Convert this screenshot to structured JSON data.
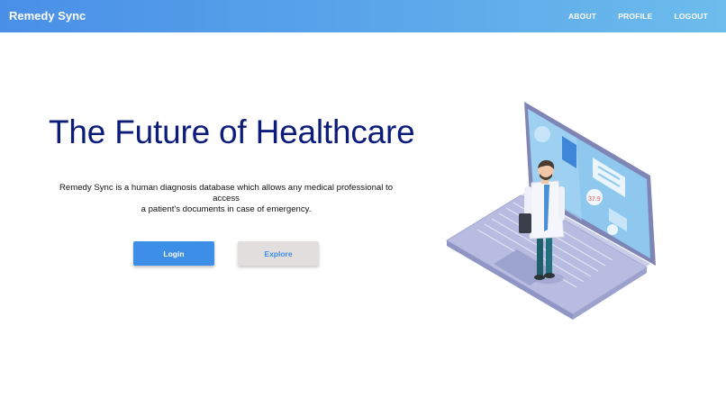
{
  "navbar": {
    "brand": "Remedy Sync",
    "links": [
      "ABOUT",
      "PROFILE",
      "LOGOUT"
    ]
  },
  "hero": {
    "title": "The Future of Healthcare",
    "description_line1": "Remedy Sync is a human diagnosis database which allows any medical professional to access",
    "description_line2": "a patient's documents in case of emergency.",
    "login_label": "Login",
    "explore_label": "Explore",
    "temperature_reading": "37.9"
  },
  "icons": [
    "laptop-doctor-illustration"
  ],
  "colors": {
    "navbar_gradient_start": "#4a8fe7",
    "navbar_gradient_end": "#6cbcec",
    "title": "#0b1c7a",
    "login_button": "#3d8ee6",
    "explore_button": "#e2dede"
  }
}
